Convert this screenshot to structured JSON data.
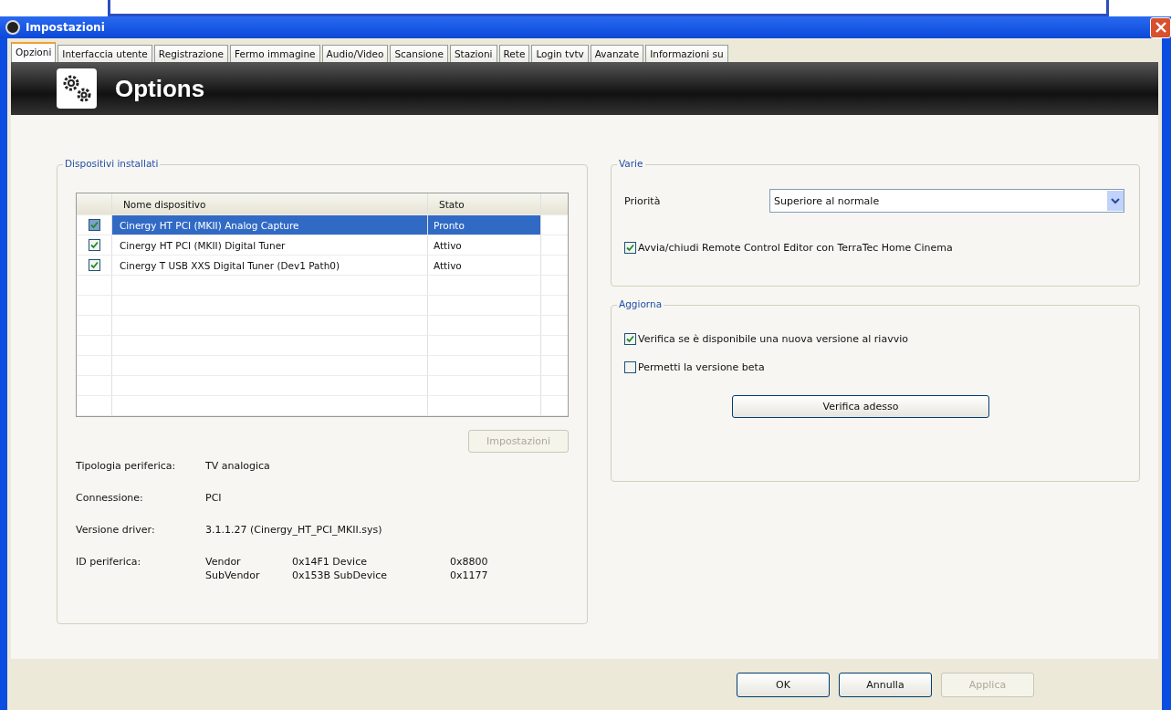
{
  "window": {
    "title": "Impostazioni"
  },
  "tabs": [
    {
      "label": "Opzioni",
      "selected": true
    },
    {
      "label": "Interfaccia utente",
      "selected": false
    },
    {
      "label": "Registrazione",
      "selected": false
    },
    {
      "label": "Fermo immagine",
      "selected": false
    },
    {
      "label": "Audio/Video",
      "selected": false
    },
    {
      "label": "Scansione",
      "selected": false
    },
    {
      "label": "Stazioni",
      "selected": false
    },
    {
      "label": "Rete",
      "selected": false
    },
    {
      "label": "Login tvtv",
      "selected": false
    },
    {
      "label": "Avanzate",
      "selected": false
    },
    {
      "label": "Informazioni su",
      "selected": false
    }
  ],
  "banner": {
    "title": "Options"
  },
  "devices": {
    "title": "Dispositivi installati",
    "table": {
      "columns": [
        "Nome dispositivo",
        "Stato"
      ],
      "rows": [
        {
          "name": "Cinergy HT PCI (MKII) Analog Capture",
          "status": "Pronto",
          "checked": true,
          "selected": true
        },
        {
          "name": "Cinergy HT PCI (MKII) Digital Tuner",
          "status": "Attivo",
          "checked": true,
          "selected": false
        },
        {
          "name": "Cinergy T USB XXS Digital Tuner (Dev1 Path0)",
          "status": "Attivo",
          "checked": true,
          "selected": false
        }
      ]
    },
    "settings_button": {
      "label": "Impostazioni",
      "disabled": true
    },
    "info": [
      {
        "label": "Tipologia periferica:",
        "value": "TV analogica"
      },
      {
        "label": "Connessione:",
        "value": "PCI"
      },
      {
        "label": "Versione driver:",
        "value": "3.1.1.27 (Cinergy_HT_PCI_MKII.sys)"
      }
    ],
    "device_id": {
      "label": "ID periferica:",
      "rows": [
        [
          "Vendor",
          "0x14F1 Device",
          "0x8800"
        ],
        [
          "SubVendor",
          "0x153B SubDevice",
          "0x1177"
        ]
      ]
    }
  },
  "misc": {
    "title": "Varie",
    "priority": {
      "label": "Priorità",
      "value": "Superiore al normale"
    },
    "checkboxes": [
      {
        "label": "Avvia/chiudi Remote Control Editor con TerraTec Home Cinema",
        "checked": true
      }
    ]
  },
  "update": {
    "title": "Aggiorna",
    "checkboxes": [
      {
        "label": "Verifica se è disponibile una nuova versione al riavvio",
        "checked": true
      },
      {
        "label": "Permetti la versione beta",
        "checked": false
      }
    ],
    "button": {
      "label": "Verifica adesso"
    }
  },
  "buttons": [
    {
      "label": "OK",
      "disabled": false
    },
    {
      "label": "Annulla",
      "disabled": false
    },
    {
      "label": "Applica",
      "disabled": true
    }
  ]
}
